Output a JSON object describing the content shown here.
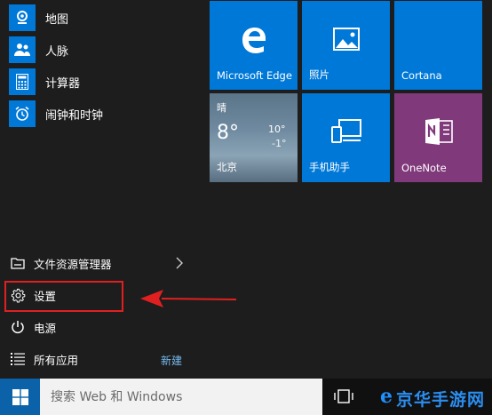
{
  "apps": [
    {
      "label": "地图",
      "icon": "map-icon"
    },
    {
      "label": "人脉",
      "icon": "people-icon"
    },
    {
      "label": "计算器",
      "icon": "calculator-icon"
    },
    {
      "label": "闹钟和时钟",
      "icon": "alarm-clock-icon"
    }
  ],
  "system": {
    "explorer_label": "文件资源管理器",
    "settings_label": "设置",
    "power_label": "电源",
    "allapps_label": "所有应用",
    "new_label": "新建"
  },
  "tiles": [
    {
      "label": "Microsoft Edge",
      "icon": "edge-icon",
      "color": "#0078d7"
    },
    {
      "label": "照片",
      "icon": "photos-icon",
      "color": "#0078d7"
    },
    {
      "label": "Cortana",
      "icon": "cortana-icon",
      "color": "#0078d7"
    },
    {
      "label": "北京",
      "icon": "weather",
      "color": "#6f8aa0"
    },
    {
      "label": "手机助手",
      "icon": "phone-companion-icon",
      "color": "#0078d7"
    },
    {
      "label": "OneNote",
      "icon": "onenote-icon",
      "color": "#80397b"
    }
  ],
  "weather": {
    "condition": "晴",
    "temp": "8°",
    "high": "10°",
    "low": "-1°"
  },
  "taskbar": {
    "search_placeholder": "搜索 Web 和 Windows"
  },
  "watermark": {
    "mark": "e",
    "text": "京华手游网"
  },
  "colors": {
    "accent": "#0078d7",
    "onenote": "#80397b",
    "highlight": "#e02020",
    "link": "#76b9ed"
  }
}
